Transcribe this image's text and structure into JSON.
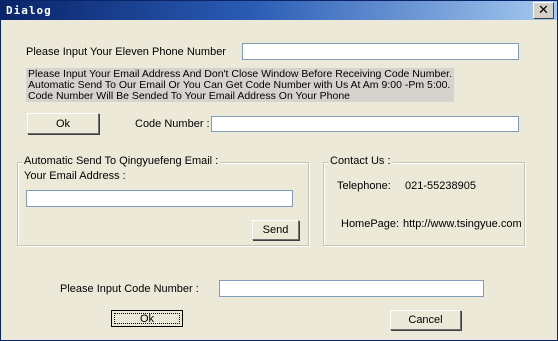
{
  "window": {
    "title": "Dialog"
  },
  "titlebar": {
    "close_glyph": "✕"
  },
  "phone": {
    "label": "Please Input Your Eleven Phone Number",
    "value": ""
  },
  "notice": {
    "lines": [
      "Please Input Your Email Address And Don't Close Window Before Receiving Code Number.",
      "Automatic Send To Our Email Or You Can Get  Code Number  with Us At Am 9:00 -Pm 5:00.",
      "Code Number Will Be Sended To Your Email Address On Your Phone"
    ]
  },
  "code_row": {
    "ok_label": "Ok",
    "label": "Code Number :",
    "value": ""
  },
  "email_group": {
    "title": "Automatic Send To Qingyuefeng Email :",
    "email_label": "Your Email Address :",
    "email_value": "",
    "send_label": "Send"
  },
  "contact_group": {
    "title": "Contact Us :",
    "telephone_label": "Telephone:",
    "telephone_value": "021-55238905",
    "homepage_label": "HomePage:",
    "homepage_value": "http://www.tsingyue.com"
  },
  "bottom": {
    "code_label": "Please Input Code Number :",
    "code_value": "",
    "ok_label": "Ok",
    "cancel_label": "Cancel"
  }
}
